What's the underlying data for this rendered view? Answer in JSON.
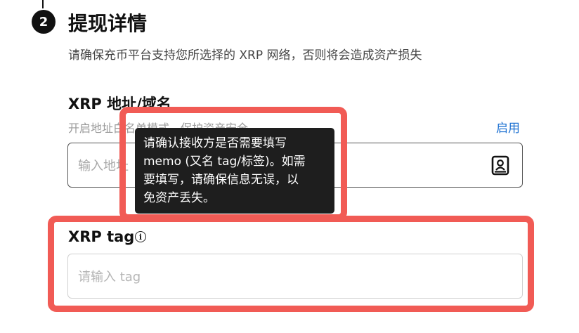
{
  "step": {
    "number": "2",
    "title": "提现详情"
  },
  "subtitle": "请确保充币平台支持您所选择的 XRP 网络，否则将会造成资产损失",
  "address": {
    "label": "XRP 地址/域名",
    "hint": "开启地址白名单模式，保护资产安全",
    "enable_link": "启用",
    "placeholder": "输入地址"
  },
  "tooltip": "请确认接收方是否需要填写\nmemo (又名 tag/标签)。如需\n要填写，请确保信息无误，以\n免资产丢失。",
  "tag": {
    "label": "XRP tag",
    "info_symbol": "i",
    "placeholder": "请输入 tag"
  },
  "colors": {
    "highlight": "#f15b55",
    "link": "#1a6fd1"
  },
  "icons": {
    "address_book": "address-book-icon",
    "info": "info-icon"
  }
}
